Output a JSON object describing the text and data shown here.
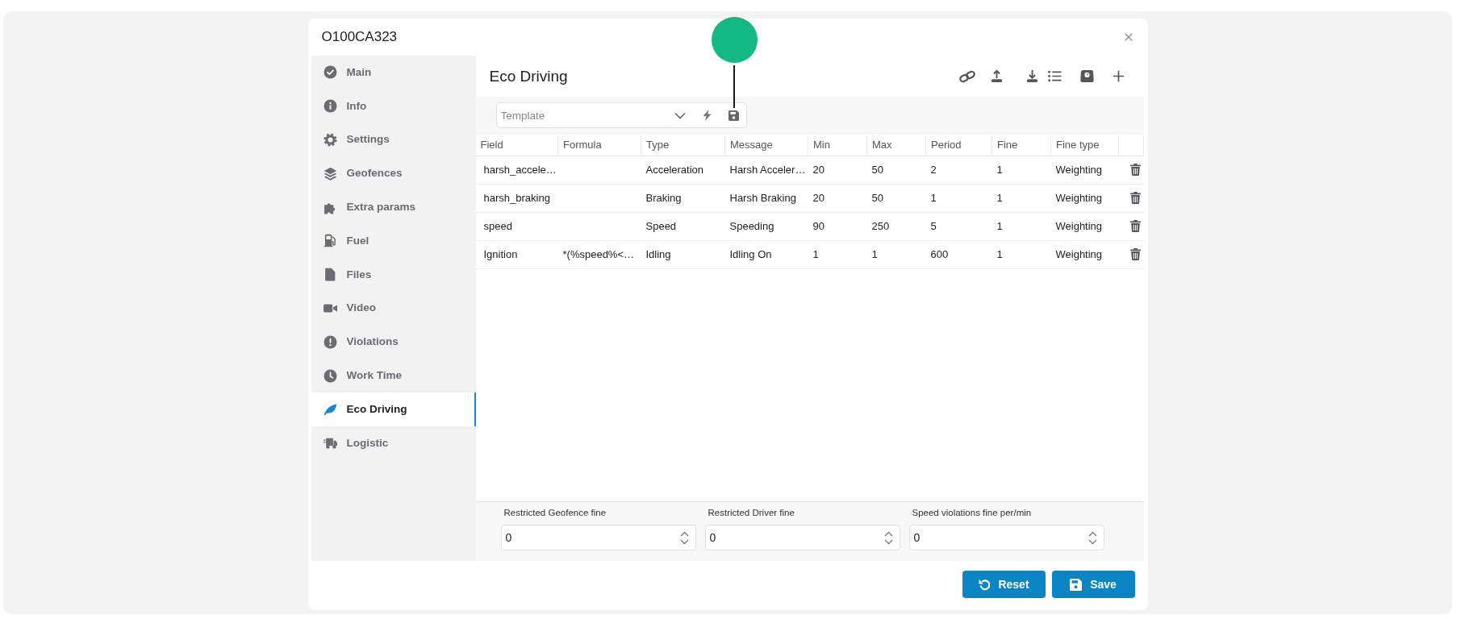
{
  "window": {
    "title": "O100CA323"
  },
  "sidebar": {
    "items": [
      {
        "label": "Main",
        "selected": false
      },
      {
        "label": "Info",
        "selected": false
      },
      {
        "label": "Settings",
        "selected": false
      },
      {
        "label": "Geofences",
        "selected": false
      },
      {
        "label": "Extra params",
        "selected": false
      },
      {
        "label": "Fuel",
        "selected": false
      },
      {
        "label": "Files",
        "selected": false
      },
      {
        "label": "Video",
        "selected": false
      },
      {
        "label": "Violations",
        "selected": false
      },
      {
        "label": "Work Time",
        "selected": false
      },
      {
        "label": "Eco Driving",
        "selected": true
      },
      {
        "label": "Logistic",
        "selected": false
      }
    ]
  },
  "panel": {
    "title": "Eco Driving",
    "template": {
      "placeholder": "Template"
    }
  },
  "table": {
    "columns": [
      "Field",
      "Formula",
      "Type",
      "Message",
      "Min",
      "Max",
      "Period",
      "Fine",
      "Fine type"
    ],
    "rows": [
      {
        "field": "harsh_accele…",
        "type": "Acceleration",
        "message": "Harsh Acceler…",
        "min": "20",
        "max": "50",
        "period": "2",
        "fine": "1",
        "fine_type": "Weighting"
      },
      {
        "field": "harsh_braking",
        "type": "Braking",
        "message": "Harsh Braking",
        "min": "20",
        "max": "50",
        "period": "1",
        "fine": "1",
        "fine_type": "Weighting"
      },
      {
        "field": "speed",
        "type": "Speed",
        "message": "Speeding",
        "min": "90",
        "max": "250",
        "period": "5",
        "fine": "1",
        "fine_type": "Weighting"
      },
      {
        "field": "Ignition",
        "formula": "*(%speed%<…",
        "type": "Idling",
        "message": "Idling On",
        "min": "1",
        "max": "1",
        "period": "600",
        "fine": "1",
        "fine_type": "Weighting"
      }
    ]
  },
  "fines": [
    {
      "label": "Restricted Geofence fine",
      "value": "0"
    },
    {
      "label": "Restricted Driver fine",
      "value": "0"
    },
    {
      "label": "Speed violations fine per/min",
      "value": "0"
    }
  ],
  "buttons": [
    {
      "label": "Reset",
      "kind": "reset"
    },
    {
      "label": "Save",
      "kind": "save"
    }
  ]
}
